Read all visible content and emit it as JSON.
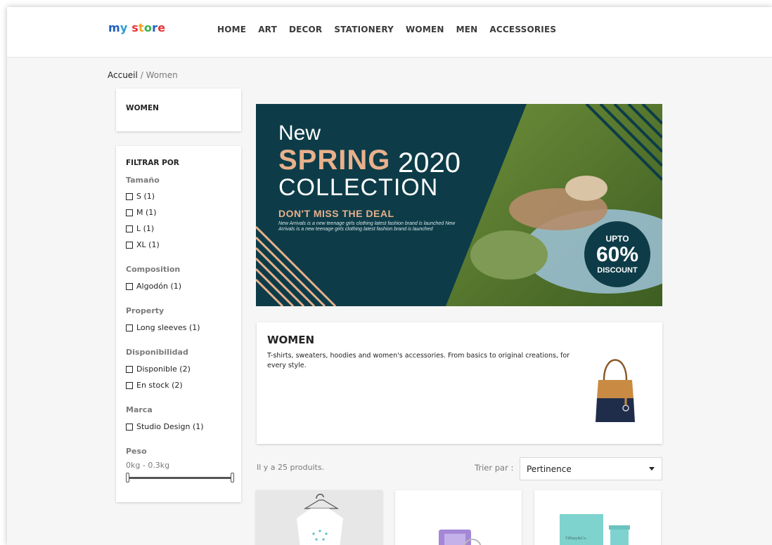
{
  "logo": {
    "parts": [
      "m",
      "y",
      " ",
      "s",
      "t",
      "o",
      "r",
      "e"
    ]
  },
  "logo_text": "my store",
  "nav": [
    "HOME",
    "ART",
    "DECOR",
    "STATIONERY",
    "WOMEN",
    "MEN",
    "ACCESSORIES"
  ],
  "breadcrumb": {
    "home": "Accueil",
    "sep": "/",
    "current": "Women"
  },
  "category_box": {
    "title": "WOMEN"
  },
  "filters": {
    "title": "FILTRAR POR",
    "groups": [
      {
        "title": "Tamaño",
        "options": [
          "S (1)",
          "M (1)",
          "L (1)",
          "XL (1)"
        ]
      },
      {
        "title": "Composition",
        "options": [
          "Algodón (1)"
        ]
      },
      {
        "title": "Property",
        "options": [
          "Long sleeves (1)"
        ]
      },
      {
        "title": "Disponibilidad",
        "options": [
          "Disponible (2)",
          "En stock (2)"
        ]
      },
      {
        "title": "Marca",
        "options": [
          "Studio Design (1)"
        ]
      },
      {
        "title": "Peso",
        "range": "0kg - 0.3kg"
      }
    ]
  },
  "banner": {
    "new": "New",
    "spring": "SPRING",
    "year": "2020",
    "collection": "COLLECTION",
    "deal": "DON'T MISS THE DEAL",
    "small": "New Arrivals is a new teenage girls clothing latest fashion brand is launched New Arrivals is a new teenage girls clothing latest fashion brand is launched",
    "badge_upto": "UPTO",
    "badge_percent": "60%",
    "badge_discount": "DISCOUNT"
  },
  "description": {
    "title": "WOMEN",
    "text": "T-shirts, sweaters, hoodies and women's accessories. From basics to original creations, for every style."
  },
  "listing": {
    "count": "Il y a 25 produits.",
    "sort_label": "Trier par :",
    "sort_value": "Pertinence"
  },
  "product_tiles": {
    "tiffany_label": "Tiffany&Co."
  },
  "colors": {
    "banner_bg": "#0d3c48",
    "accent": "#e9b08b"
  },
  "icons": [
    "checkbox-icon",
    "chevron-down-icon",
    "range-handle-icon"
  ]
}
